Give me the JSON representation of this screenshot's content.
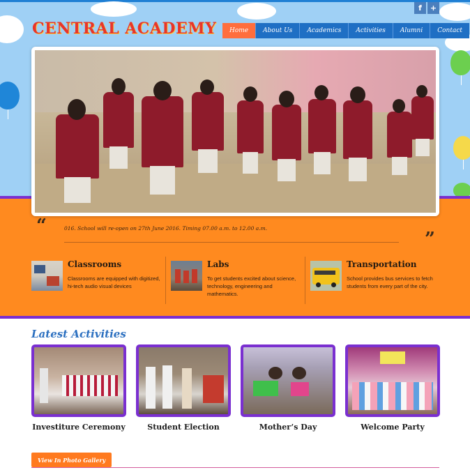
{
  "site": {
    "logo_text": "CENTRAL ACADEMY"
  },
  "social": {
    "facebook_glyph": "f",
    "plus_glyph": "+"
  },
  "nav": {
    "items": [
      {
        "label": "Home",
        "active": true
      },
      {
        "label": "About Us",
        "active": false
      },
      {
        "label": "Academics",
        "active": false
      },
      {
        "label": "Activities",
        "active": false
      },
      {
        "label": "Alumni",
        "active": false
      },
      {
        "label": "Contact",
        "active": false
      }
    ]
  },
  "notice": {
    "text": "016. School will re-open on 27th June 2016. Timing 07.00 a.m. to 12.00 a.m."
  },
  "features": [
    {
      "title": "Classrooms",
      "desc": "Classrooms are equipped with digitized, hi-tech audio visual devices"
    },
    {
      "title": "Labs",
      "desc": "To get students excited about science, technology, engineering and mathematics."
    },
    {
      "title": "Transportation",
      "desc": "School provides bus services to fetch students from every part of the city."
    }
  ],
  "activities": {
    "heading": "Latest Activities",
    "items": [
      {
        "label": "Investiture Ceremony"
      },
      {
        "label": "Student Election"
      },
      {
        "label": "Mother’s Day"
      },
      {
        "label": "Welcome Party"
      }
    ],
    "gallery_button": "View In Photo Gallery"
  },
  "colors": {
    "sky": "#9fd0f5",
    "nav_blue": "#1f6fc4",
    "nav_active": "#ff6e3d",
    "orange_band": "#ff8a1f",
    "purple_border": "#7a2fd0",
    "logo_red": "#e8352a",
    "heading_blue": "#2c70c0"
  }
}
